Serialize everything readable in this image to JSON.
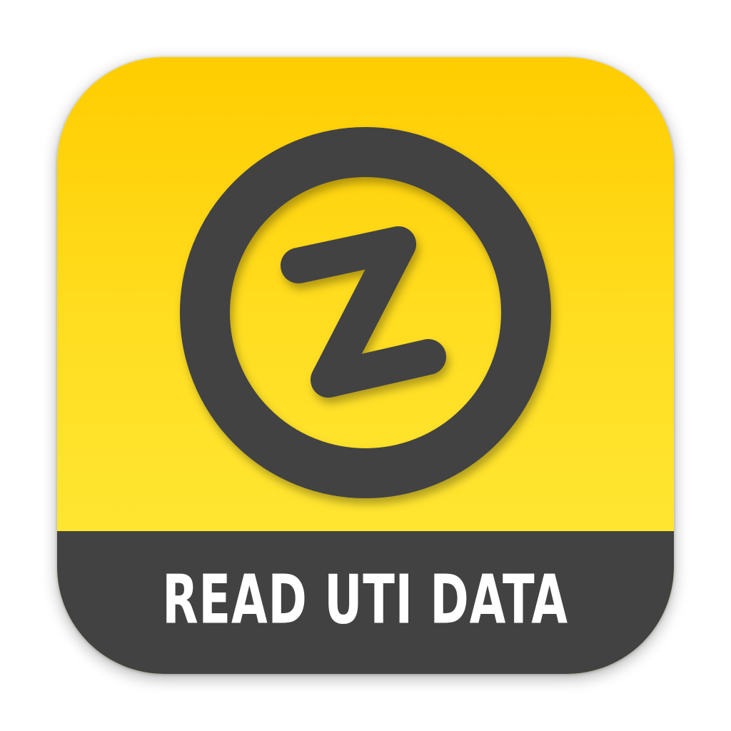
{
  "app_icon": {
    "logo_icon": "z-in-circle-logo-icon",
    "label": "READ UTI DATA",
    "colors": {
      "background_top": "#FFCD00",
      "background_bottom": "#FFEB3C",
      "ring_and_band": "#424242",
      "label_text": "#FFFFFF"
    }
  }
}
